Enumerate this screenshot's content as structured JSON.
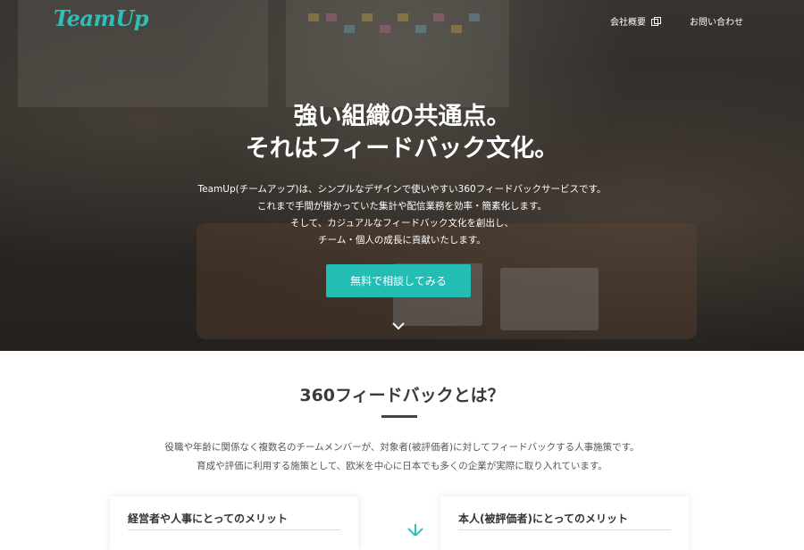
{
  "header": {
    "logo": "TeamUp",
    "nav": [
      {
        "label": "会社概要",
        "icon": "external-link-icon"
      },
      {
        "label": "お問い合わせ"
      }
    ]
  },
  "hero": {
    "headline_1": "強い組織の共通点。",
    "headline_2": "それはフィードバック文化。",
    "description": [
      "TeamUp(チームアップ)は、シンプルなデザインで使いやすい360フィードバックサービスです。",
      "これまで手間が掛かっていた集計や配信業務を効率・簡素化します。",
      "そして、カジュアルなフィードバック文化を創出し、",
      "チーム・個人の成長に貢献いたします。"
    ],
    "cta_label": "無料で相談してみる",
    "scroll_icon": "chevron-down-icon"
  },
  "section": {
    "title": "360フィードバックとは？",
    "text": [
      "役職や年齢に関係なく複数名のチームメンバーが、対象者(被評価者)に対してフィードバックする人事施策です。",
      "育成や評価に利用する施策として、欧米を中心に日本でも多くの企業が実際に取り入れています。"
    ],
    "cards": [
      {
        "title": "経営者や人事にとってのメリット"
      },
      {
        "title": "本人(被評価者)にとってのメリット"
      }
    ]
  },
  "colors": {
    "accent": "#24bdb4",
    "logo": "#2ebfb8",
    "heading": "#3a3a3a"
  }
}
